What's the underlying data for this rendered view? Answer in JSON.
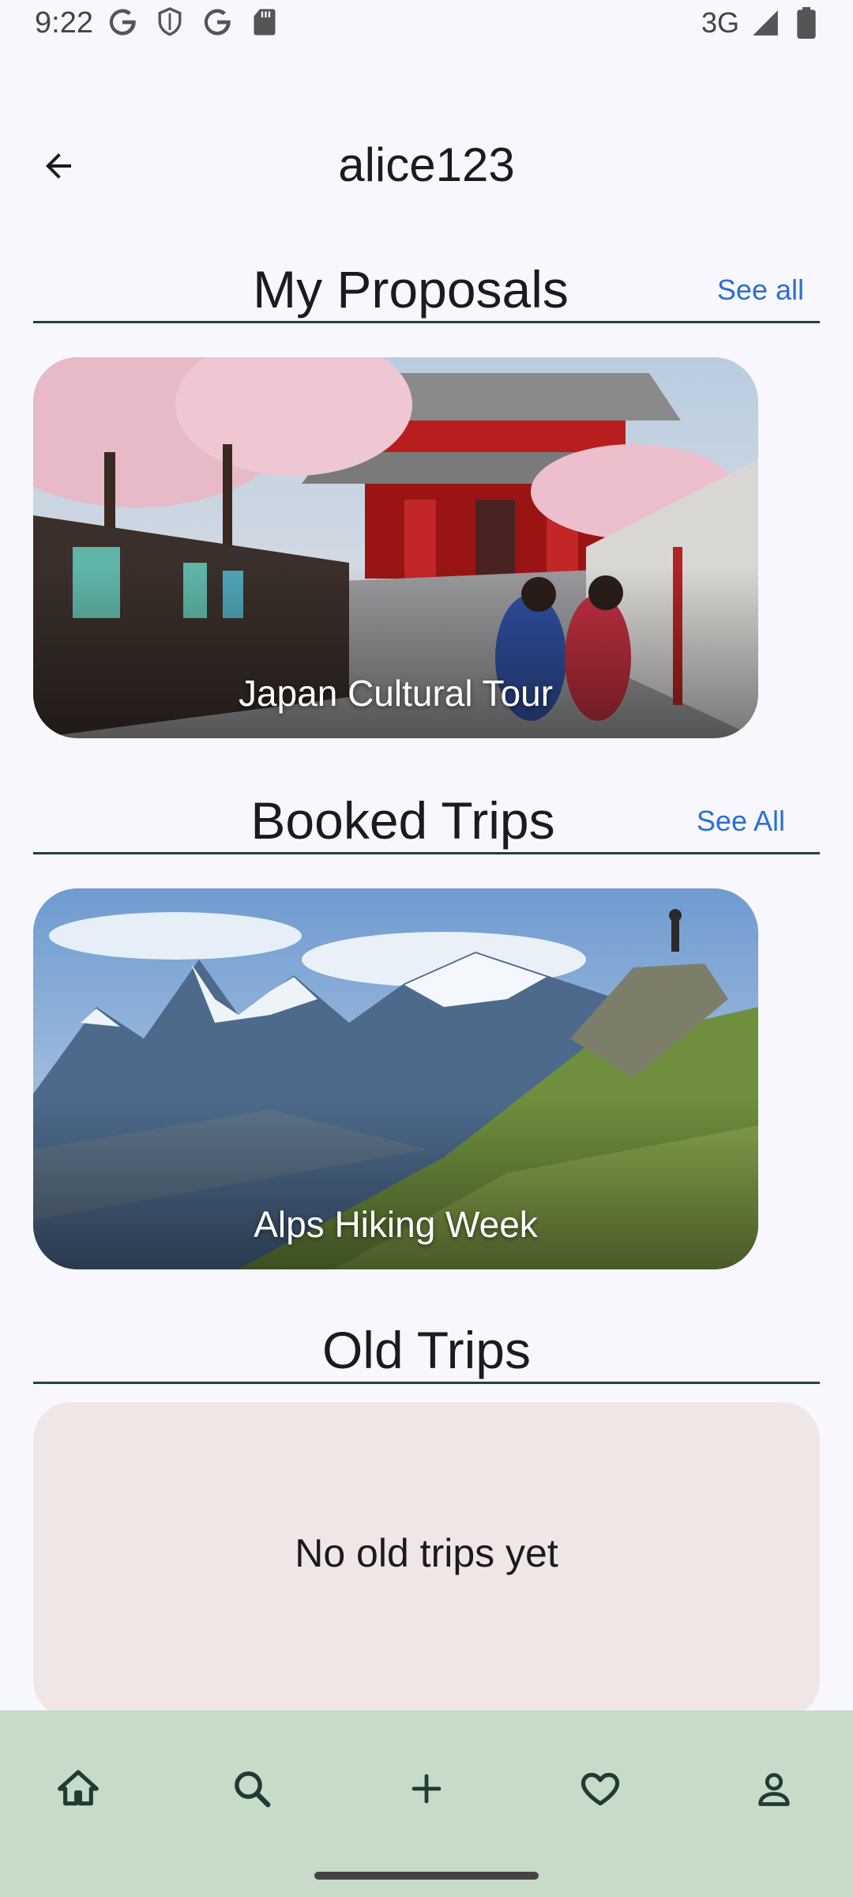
{
  "status_bar": {
    "time": "9:22",
    "network": "3G",
    "left_icons": [
      "google-icon",
      "shield-icon",
      "google-icon",
      "sd-card-icon"
    ],
    "right_icons": [
      "signal-icon",
      "battery-icon"
    ]
  },
  "app_bar": {
    "title": "alice123",
    "back_icon": "arrow-back-icon"
  },
  "sections": {
    "proposals": {
      "title": "My Proposals",
      "see_all": "See all",
      "card_title": "Japan Cultural Tour"
    },
    "booked": {
      "title": "Booked Trips",
      "see_all": "See All",
      "card_title": "Alps Hiking Week"
    },
    "old": {
      "title": "Old Trips",
      "empty_message": "No old trips yet"
    }
  },
  "bottom_nav": {
    "items": [
      "home-icon",
      "search-icon",
      "add-icon",
      "favorite-icon",
      "profile-icon"
    ]
  },
  "colors": {
    "background": "#f8f7fd",
    "accent_link": "#2a6fd6",
    "divider": "#20443a",
    "nav_background": "#c8dac8",
    "empty_card": "#f0e6e6"
  }
}
